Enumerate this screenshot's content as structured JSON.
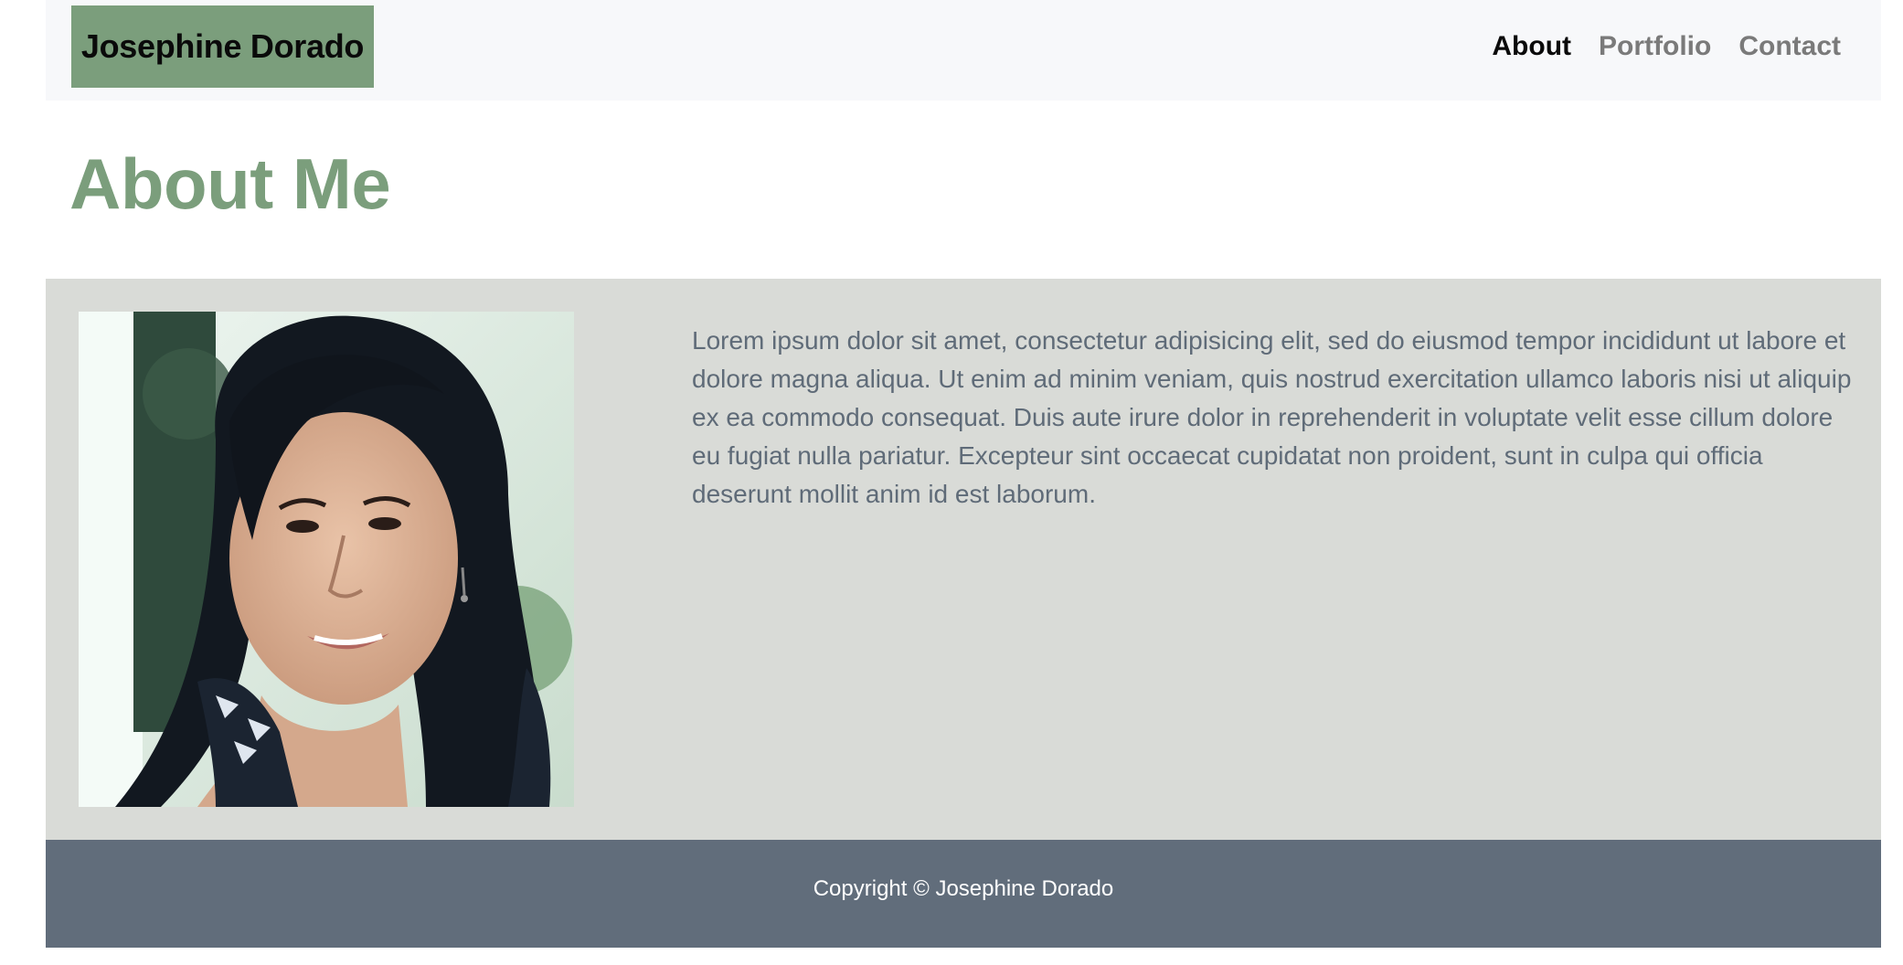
{
  "header": {
    "brand": "Josephine Dorado",
    "nav": [
      {
        "label": "About",
        "active": true
      },
      {
        "label": "Portfolio",
        "active": false
      },
      {
        "label": "Contact",
        "active": false
      }
    ]
  },
  "main": {
    "title": "About Me",
    "photo_alt": "Portrait of Josephine Dorado",
    "bio": "Lorem ipsum dolor sit amet, consectetur adipisicing elit, sed do eiusmod tempor incididunt ut labore et dolore magna aliqua. Ut enim ad minim veniam, quis nostrud exercitation ullamco laboris nisi ut aliquip ex ea commodo consequat. Duis aute irure dolor in reprehenderit in voluptate velit esse cillum dolore eu fugiat nulla pariatur. Excepteur sint occaecat cupidatat non proident, sunt in culpa qui officia deserunt mollit anim id est laborum."
  },
  "footer": {
    "copyright": "Copyright © Josephine Dorado"
  },
  "colors": {
    "accent": "#7b9e7c",
    "header_bg": "#f7f8fa",
    "section_bg": "#d9dbd7",
    "footer_bg": "#616d7b",
    "body_text": "#5f6b78"
  }
}
